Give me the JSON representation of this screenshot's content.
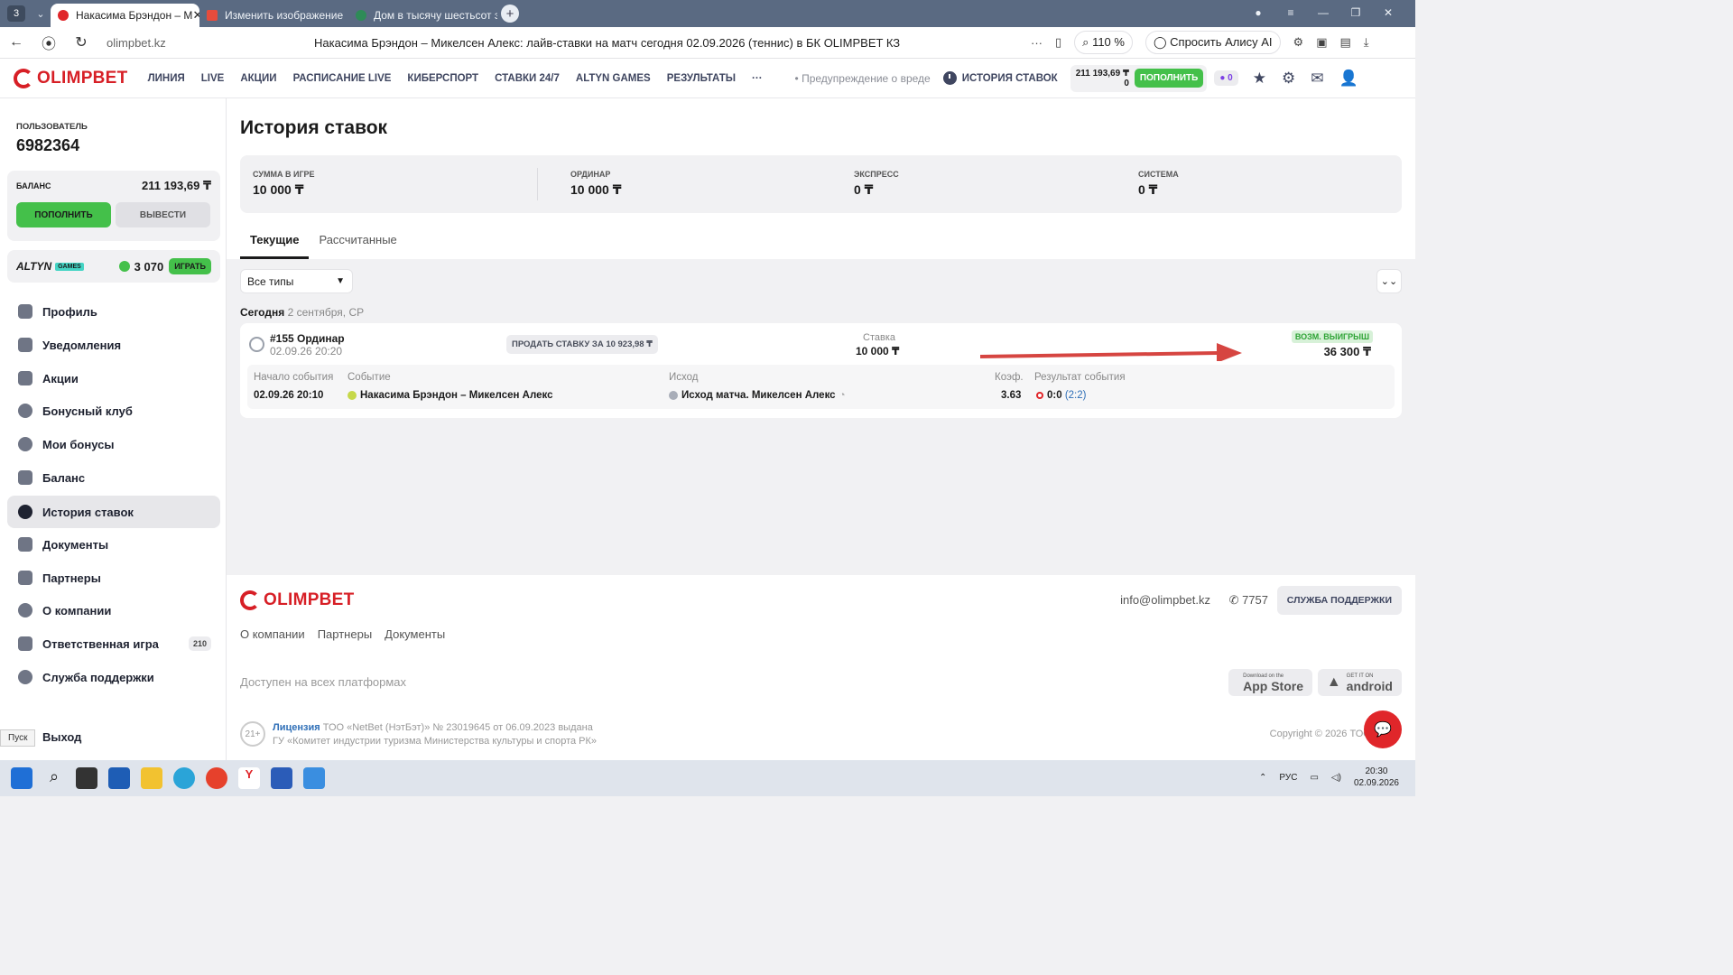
{
  "browser": {
    "tab_count": "3",
    "tabs": [
      {
        "title": "Накасима Брэндон – М",
        "color": "#e0262a"
      },
      {
        "title": "Изменить изображение",
        "color": "#e74c3c"
      },
      {
        "title": "Дом в тысячу шестьсот э",
        "color": "#2e8b57"
      }
    ],
    "url": "olimpbet.kz",
    "page_title": "Накасима Брэндон – Микелсен Алекс: лайв-ставки на матч сегодня 02.09.2026 (теннис) в БК OLIMPBET КЗ",
    "zoom": "110 %",
    "alice": "Спросить Алису AI"
  },
  "header": {
    "brand": "OLIMPBET",
    "menu": [
      "ЛИНИЯ",
      "LIVE",
      "АКЦИИ",
      "РАСПИСАНИЕ LIVE",
      "КИБЕРСПОРТ",
      "СТАВКИ 24/7",
      "ALTYN GAMES",
      "РЕЗУЛЬТАТЫ"
    ],
    "more": "···",
    "warning": "Предупреждение о вреде",
    "history": "ИСТОРИЯ СТАВОК",
    "balance": "211 193,69 ₸",
    "bonus": "0",
    "deposit": "ПОПОЛНИТЬ",
    "promo_count": "0"
  },
  "sidebar": {
    "user_label": "ПОЛЬЗОВАТЕЛЬ",
    "user_id": "6982364",
    "balance_label": "БАЛАНС",
    "balance": "211 193,69 ₸",
    "deposit": "ПОПОЛНИТЬ",
    "withdraw": "ВЫВЕСТИ",
    "altyn_brand": "ALTYN",
    "altyn_games": "GAMES",
    "altyn_coins": "3 070",
    "altyn_play": "ИГРАТЬ",
    "items": [
      {
        "label": "Профиль"
      },
      {
        "label": "Уведомления"
      },
      {
        "label": "Акции"
      },
      {
        "label": "Бонусный клуб"
      },
      {
        "label": "Мои бонусы"
      },
      {
        "label": "Баланс"
      },
      {
        "label": "История ставок"
      },
      {
        "label": "Документы"
      },
      {
        "label": "Партнеры"
      },
      {
        "label": "О компании"
      },
      {
        "label": "Ответственная игра",
        "badge": "210"
      },
      {
        "label": "Служба поддержки"
      }
    ],
    "exit": "Выход",
    "start_tooltip": "Пуск"
  },
  "main": {
    "title": "История ставок",
    "summary": [
      {
        "label": "СУММА В ИГРЕ",
        "value": "10 000 ₸"
      },
      {
        "label": "ОРДИНАР",
        "value": "10 000 ₸"
      },
      {
        "label": "ЭКСПРЕСС",
        "value": "0 ₸"
      },
      {
        "label": "СИСТЕМА",
        "value": "0 ₸"
      }
    ],
    "tabs": [
      "Текущие",
      "Рассчитанные"
    ],
    "filter": "Все типы",
    "day_label": "Сегодня",
    "day_date": "2 сентября, СР",
    "bet": {
      "title": "#155 Ординар",
      "date": "02.09.26 20:20",
      "sell": "ПРОДАТЬ СТАВКУ ЗА 10 923,98 ₸",
      "stake_label": "Ставка",
      "stake": "10 000 ₸",
      "win_label": "ВОЗМ. ВЫИГРЫШ",
      "win": "36 300 ₸",
      "headers": {
        "start": "Начало события",
        "event": "Событие",
        "outcome": "Исход",
        "coef": "Коэф.",
        "result": "Результат события"
      },
      "start": "02.09.26 20:10",
      "event": "Накасима Брэндон – Микелсен Алекс",
      "outcome": "Исход матча. Микелсен Алекс",
      "coef": "3.63",
      "score": "0:0",
      "score_sets": "(2:2)"
    }
  },
  "footer": {
    "brand": "OLIMPBET",
    "email": "info@olimpbet.kz",
    "phone": "7757",
    "support": "СЛУЖБА ПОДДЕРЖКИ",
    "links": [
      "О компании",
      "Партнеры",
      "Документы"
    ],
    "platforms": "Доступен на всех платформах",
    "appstore_small": "Download on the",
    "appstore": "App Store",
    "android_small": "GET IT ON",
    "android": "android",
    "age": "21+",
    "license_link": "Лицензия",
    "license_line1": "ТОО «NetBet (НэтБэт)» № 23019645 от 06.09.2023 выдана",
    "license_line2": "ГУ «Комитет индустрии туризма Министерства культуры и спорта РК»",
    "copyright": "Copyright © 2026 ТОО «"
  },
  "taskbar": {
    "lang": "РУС",
    "time": "20:30",
    "date": "02.09.2026"
  },
  "colors": {
    "brand_red": "#d71f26",
    "green": "#44c04a",
    "arrow_red": "#d64541"
  }
}
